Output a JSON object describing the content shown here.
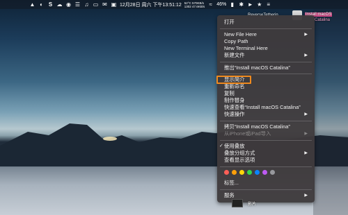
{
  "menubar": {
    "app_icons": [
      "fox-icon",
      "shield-icon",
      "s-icon",
      "cloud-icon",
      "ghost-icon",
      "bars-icon",
      "music-icon",
      "monitor-icon",
      "chat-icon",
      "display-icon"
    ],
    "stats_top": "52°C  570KB/s",
    "stats_bottom": "1302  47.6KB/s",
    "datetime": "12月28日 周六 下午13:51:12",
    "battery": "46%"
  },
  "desktop_labels": {
    "top_left_name": "ReverseTetherin",
    "top_right_name": "Install macOS",
    "top_right_sub": "Catalina"
  },
  "context_menu": {
    "open": "打开",
    "new_file_here": "New File Here",
    "copy_path": "Copy Path",
    "new_terminal_here": "New Terminal Here",
    "new_file": "新建文件",
    "eject": "推出“Install macOS Catalina”",
    "get_info": "显示简介",
    "rename": "重新命名",
    "duplicate": "复制",
    "make_alias": "制作替身",
    "quick_look": "快速查看“Install macOS Catalina”",
    "quick_actions": "快速操作",
    "copy_item": "拷贝“Install macOS Catalina”",
    "import_from_iphone": "从iPhone或iPad导入",
    "use_stacks": "使用叠放",
    "group_stacks_by": "叠放分组方式",
    "show_view_options": "查看显示选项",
    "tags": "标签...",
    "services": "服务"
  },
  "tag_colors": [
    "#ff5f57",
    "#ff9f0a",
    "#ffd60a",
    "#32d74b",
    "#0a84ff",
    "#bf5af2",
    "#98989d"
  ],
  "bottom_file_label": "影片"
}
